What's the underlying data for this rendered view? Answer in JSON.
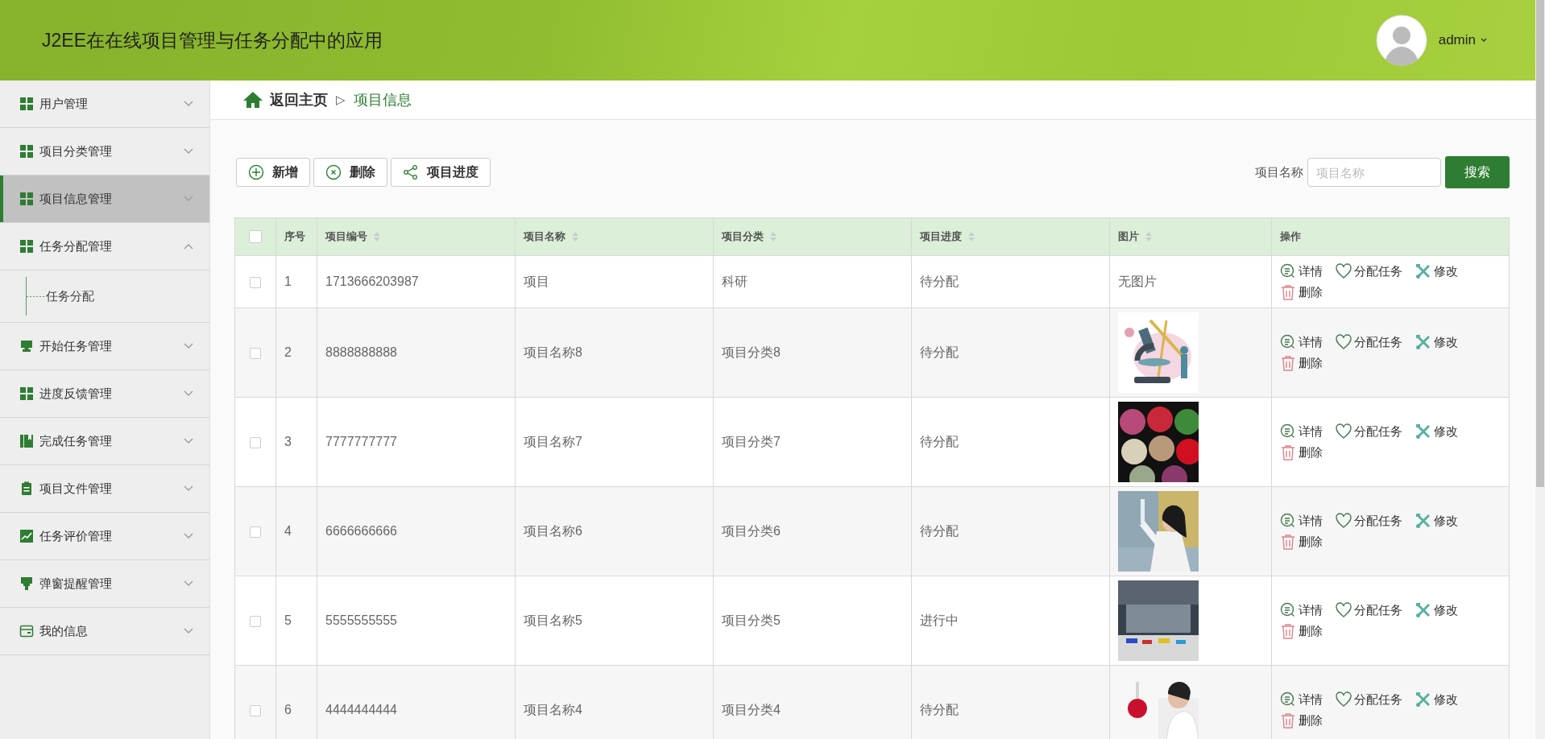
{
  "header": {
    "title": "J2EE在在线项目管理与任务分配中的应用",
    "user": "admin"
  },
  "sidebar": {
    "items": [
      {
        "label": "用户管理",
        "kind": "grid",
        "selected": false,
        "expanded": false
      },
      {
        "label": "项目分类管理",
        "kind": "grid",
        "selected": false,
        "expanded": false
      },
      {
        "label": "项目信息管理",
        "kind": "grid",
        "selected": true,
        "expanded": false
      },
      {
        "label": "任务分配管理",
        "kind": "grid",
        "selected": false,
        "expanded": true,
        "children": [
          {
            "label": "任务分配",
            "selected": false
          }
        ]
      },
      {
        "label": "开始任务管理",
        "kind": "tray",
        "selected": false,
        "expanded": false
      },
      {
        "label": "进度反馈管理",
        "kind": "grid",
        "selected": false,
        "expanded": false
      },
      {
        "label": "完成任务管理",
        "kind": "book",
        "selected": false,
        "expanded": false
      },
      {
        "label": "项目文件管理",
        "kind": "clipboard",
        "selected": false,
        "expanded": false
      },
      {
        "label": "任务评价管理",
        "kind": "chart",
        "selected": false,
        "expanded": false
      },
      {
        "label": "弹窗提醒管理",
        "kind": "stamp",
        "selected": false,
        "expanded": false
      },
      {
        "label": "我的信息",
        "kind": "card",
        "selected": false,
        "expanded": false
      }
    ]
  },
  "breadcrumb": {
    "home": "返回主页",
    "separator": "▷",
    "current": "项目信息"
  },
  "toolbar": {
    "buttons": [
      {
        "label": "新增",
        "kind": "plus"
      },
      {
        "label": "删除",
        "kind": "cross"
      },
      {
        "label": "项目进度",
        "kind": "share"
      }
    ],
    "search": {
      "label": "项目名称",
      "placeholder": "项目名称",
      "button": "搜索"
    }
  },
  "table": {
    "select_all": {
      "checked": false
    },
    "columns": [
      {
        "label": "序号",
        "sortable": false
      },
      {
        "label": "项目编号",
        "sortable": true
      },
      {
        "label": "项目名称",
        "sortable": true
      },
      {
        "label": "项目分类",
        "sortable": true
      },
      {
        "label": "项目进度",
        "sortable": true
      },
      {
        "label": "图片",
        "sortable": true
      },
      {
        "label": "操作",
        "sortable": false
      }
    ],
    "rows": [
      {
        "checked": false,
        "cells": [
          "1",
          "1713666203987",
          "项目",
          "科研",
          "待分配"
        ],
        "image": {
          "kind": "none",
          "text": "无图片"
        },
        "actions": [
          "详情",
          "分配任务",
          "修改",
          "删除"
        ]
      },
      {
        "checked": false,
        "cells": [
          "2",
          "8888888888",
          "项目名称8",
          "项目分类8",
          "待分配"
        ],
        "image": {
          "kind": "picture"
        },
        "actions": [
          "详情",
          "分配任务",
          "修改",
          "删除"
        ]
      },
      {
        "checked": false,
        "cells": [
          "3",
          "7777777777",
          "项目名称7",
          "项目分类7",
          "待分配"
        ],
        "image": {
          "kind": "picture"
        },
        "actions": [
          "详情",
          "分配任务",
          "修改",
          "删除"
        ]
      },
      {
        "checked": false,
        "cells": [
          "4",
          "6666666666",
          "项目名称6",
          "项目分类6",
          "待分配"
        ],
        "image": {
          "kind": "picture"
        },
        "actions": [
          "详情",
          "分配任务",
          "修改",
          "删除"
        ]
      },
      {
        "checked": false,
        "cells": [
          "5",
          "5555555555",
          "项目名称5",
          "项目分类5",
          "进行中"
        ],
        "image": {
          "kind": "picture"
        },
        "actions": [
          "详情",
          "分配任务",
          "修改",
          "删除"
        ]
      },
      {
        "checked": false,
        "cells": [
          "6",
          "4444444444",
          "项目名称4",
          "项目分类4",
          "待分配"
        ],
        "image": {
          "kind": "picture"
        },
        "actions": [
          "详情",
          "分配任务",
          "修改",
          "删除"
        ]
      }
    ]
  }
}
